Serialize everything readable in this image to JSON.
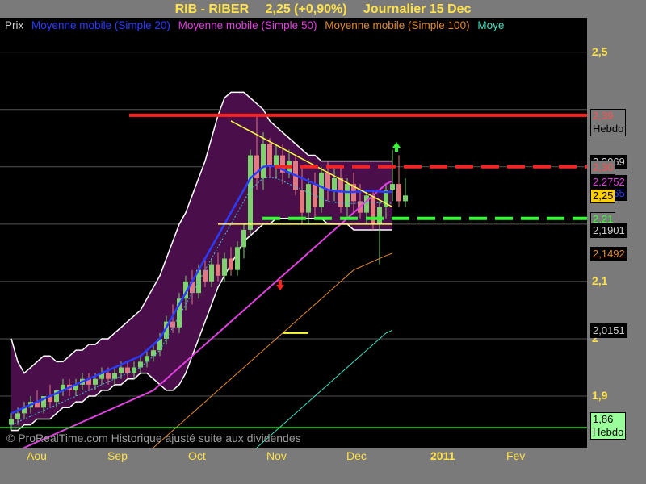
{
  "header": {
    "symbol": "RIB - RIBER",
    "price": "2,25 (+0,90%)",
    "period": "Journalier  15 Dec"
  },
  "legend": {
    "items": [
      {
        "label": "Prix",
        "color": "#cfcfcf"
      },
      {
        "label": "Moyenne mobile (Simple 20)",
        "color": "#2a3cff"
      },
      {
        "label": "Moyenne mobile (Simple 50)",
        "color": "#e040e0"
      },
      {
        "label": "Moyenne mobile (Simple 100)",
        "color": "#e08a30"
      },
      {
        "label": "Moye",
        "color": "#40e0c0"
      }
    ]
  },
  "watermark": "© ProRealTime.com Historique ajusté suite aux dividendes",
  "colors": {
    "background": "#000000",
    "axis_panel": "#7a7a7a",
    "axis_text": "#ffe14a",
    "bollinger_fill": "#4a0f4a",
    "up_candle": "#7ad46a",
    "down_candle": "#e07a80"
  },
  "chart_data": {
    "type": "candlestick",
    "ylim": [
      1.81,
      2.56
    ],
    "x_ticks": [
      "Aou",
      "Sep",
      "Oct",
      "Nov",
      "Dec",
      "2011",
      "Fev"
    ],
    "y_ticks": [
      "2,5",
      "2,1",
      "2",
      "1,9"
    ],
    "y_tick_values": [
      2.5,
      2.1,
      2.0,
      1.9
    ],
    "price_tags": [
      {
        "label": "2,39",
        "sub": "Hebdo",
        "value": 2.39,
        "bg": "#7a7a7a",
        "fg": "#ff5050"
      },
      {
        "label": "2,3069",
        "value": 2.31,
        "bg": "#000000",
        "fg": "#cfcfcf"
      },
      {
        "label": "2,30",
        "value": 2.3,
        "bg": "#7a7a7a",
        "fg": "#ff5050"
      },
      {
        "label": "2,2752",
        "value": 2.275,
        "bg": "#000000",
        "fg": "#e040e0"
      },
      {
        "label": "2,2565",
        "value": 2.255,
        "bg": "#000000",
        "fg": "#2a3cff"
      },
      {
        "label": "2,25",
        "value": 2.25,
        "bg": "#ffd000",
        "fg": "#000000"
      },
      {
        "label": "2,21",
        "value": 2.21,
        "bg": "#7a7a7a",
        "fg": "#40ff40"
      },
      {
        "label": "2,1901",
        "value": 2.19,
        "bg": "#000000",
        "fg": "#cfcfcf"
      },
      {
        "label": "2,1492",
        "value": 2.149,
        "bg": "#000000",
        "fg": "#e08a30"
      },
      {
        "label": "2,0151",
        "value": 2.015,
        "bg": "#000000",
        "fg": "#cfcfcf"
      },
      {
        "label": "1,86",
        "sub": "Hebdo",
        "value": 1.86,
        "bg": "#9aff9a",
        "fg": "#000000"
      }
    ],
    "levels": [
      {
        "value": 2.39,
        "color": "#ff2020",
        "style": "solid"
      },
      {
        "value": 2.3,
        "color": "#ff2020",
        "style": "dashed"
      },
      {
        "value": 2.21,
        "color": "#30ff30",
        "style": "dashed"
      },
      {
        "value": 1.845,
        "color": "#30ff30",
        "style": "solid"
      }
    ],
    "candles": [
      {
        "o": 1.85,
        "h": 1.87,
        "l": 1.84,
        "c": 1.86
      },
      {
        "o": 1.86,
        "h": 1.88,
        "l": 1.85,
        "c": 1.87
      },
      {
        "o": 1.87,
        "h": 1.89,
        "l": 1.86,
        "c": 1.88
      },
      {
        "o": 1.88,
        "h": 1.9,
        "l": 1.87,
        "c": 1.89
      },
      {
        "o": 1.89,
        "h": 1.91,
        "l": 1.88,
        "c": 1.88
      },
      {
        "o": 1.88,
        "h": 1.9,
        "l": 1.87,
        "c": 1.9
      },
      {
        "o": 1.9,
        "h": 1.92,
        "l": 1.88,
        "c": 1.89
      },
      {
        "o": 1.89,
        "h": 1.91,
        "l": 1.88,
        "c": 1.91
      },
      {
        "o": 1.91,
        "h": 1.93,
        "l": 1.9,
        "c": 1.92
      },
      {
        "o": 1.92,
        "h": 1.93,
        "l": 1.9,
        "c": 1.91
      },
      {
        "o": 1.91,
        "h": 1.93,
        "l": 1.9,
        "c": 1.92
      },
      {
        "o": 1.92,
        "h": 1.94,
        "l": 1.91,
        "c": 1.93
      },
      {
        "o": 1.93,
        "h": 1.94,
        "l": 1.91,
        "c": 1.92
      },
      {
        "o": 1.92,
        "h": 1.94,
        "l": 1.91,
        "c": 1.93
      },
      {
        "o": 1.93,
        "h": 1.95,
        "l": 1.92,
        "c": 1.94
      },
      {
        "o": 1.94,
        "h": 1.95,
        "l": 1.92,
        "c": 1.93
      },
      {
        "o": 1.93,
        "h": 1.95,
        "l": 1.92,
        "c": 1.94
      },
      {
        "o": 1.94,
        "h": 1.96,
        "l": 1.93,
        "c": 1.95
      },
      {
        "o": 1.95,
        "h": 1.96,
        "l": 1.93,
        "c": 1.94
      },
      {
        "o": 1.94,
        "h": 1.96,
        "l": 1.93,
        "c": 1.95
      },
      {
        "o": 1.95,
        "h": 1.97,
        "l": 1.94,
        "c": 1.96
      },
      {
        "o": 1.96,
        "h": 1.98,
        "l": 1.95,
        "c": 1.97
      },
      {
        "o": 1.97,
        "h": 1.99,
        "l": 1.96,
        "c": 1.98
      },
      {
        "o": 1.98,
        "h": 2.01,
        "l": 1.97,
        "c": 2.0
      },
      {
        "o": 2.0,
        "h": 2.04,
        "l": 1.99,
        "c": 2.03
      },
      {
        "o": 2.03,
        "h": 2.06,
        "l": 2.01,
        "c": 2.02
      },
      {
        "o": 2.02,
        "h": 2.08,
        "l": 2.01,
        "c": 2.07
      },
      {
        "o": 2.07,
        "h": 2.11,
        "l": 2.05,
        "c": 2.1
      },
      {
        "o": 2.1,
        "h": 2.12,
        "l": 2.06,
        "c": 2.08
      },
      {
        "o": 2.08,
        "h": 2.13,
        "l": 2.07,
        "c": 2.12
      },
      {
        "o": 2.12,
        "h": 2.14,
        "l": 2.09,
        "c": 2.1
      },
      {
        "o": 2.1,
        "h": 2.14,
        "l": 2.09,
        "c": 2.13
      },
      {
        "o": 2.13,
        "h": 2.15,
        "l": 2.1,
        "c": 2.11
      },
      {
        "o": 2.11,
        "h": 2.15,
        "l": 2.1,
        "c": 2.14
      },
      {
        "o": 2.14,
        "h": 2.16,
        "l": 2.11,
        "c": 2.12
      },
      {
        "o": 2.12,
        "h": 2.17,
        "l": 2.11,
        "c": 2.16
      },
      {
        "o": 2.16,
        "h": 2.2,
        "l": 2.14,
        "c": 2.19
      },
      {
        "o": 2.19,
        "h": 2.33,
        "l": 2.18,
        "c": 2.32
      },
      {
        "o": 2.32,
        "h": 2.39,
        "l": 2.26,
        "c": 2.28
      },
      {
        "o": 2.28,
        "h": 2.36,
        "l": 2.26,
        "c": 2.34
      },
      {
        "o": 2.34,
        "h": 2.35,
        "l": 2.28,
        "c": 2.3
      },
      {
        "o": 2.3,
        "h": 2.34,
        "l": 2.28,
        "c": 2.32
      },
      {
        "o": 2.32,
        "h": 2.34,
        "l": 2.27,
        "c": 2.29
      },
      {
        "o": 2.29,
        "h": 2.33,
        "l": 2.28,
        "c": 2.31
      },
      {
        "o": 2.31,
        "h": 2.32,
        "l": 2.25,
        "c": 2.26
      },
      {
        "o": 2.26,
        "h": 2.3,
        "l": 2.2,
        "c": 2.22
      },
      {
        "o": 2.22,
        "h": 2.28,
        "l": 2.2,
        "c": 2.27
      },
      {
        "o": 2.27,
        "h": 2.29,
        "l": 2.21,
        "c": 2.23
      },
      {
        "o": 2.23,
        "h": 2.3,
        "l": 2.22,
        "c": 2.29
      },
      {
        "o": 2.29,
        "h": 2.31,
        "l": 2.24,
        "c": 2.26
      },
      {
        "o": 2.26,
        "h": 2.3,
        "l": 2.24,
        "c": 2.28
      },
      {
        "o": 2.28,
        "h": 2.3,
        "l": 2.22,
        "c": 2.23
      },
      {
        "o": 2.23,
        "h": 2.28,
        "l": 2.21,
        "c": 2.27
      },
      {
        "o": 2.27,
        "h": 2.29,
        "l": 2.22,
        "c": 2.24
      },
      {
        "o": 2.24,
        "h": 2.27,
        "l": 2.21,
        "c": 2.22
      },
      {
        "o": 2.22,
        "h": 2.26,
        "l": 2.2,
        "c": 2.25
      },
      {
        "o": 2.25,
        "h": 2.26,
        "l": 2.19,
        "c": 2.2
      },
      {
        "o": 2.2,
        "h": 2.24,
        "l": 2.13,
        "c": 2.23
      },
      {
        "o": 2.23,
        "h": 2.27,
        "l": 2.21,
        "c": 2.26
      },
      {
        "o": 2.26,
        "h": 2.33,
        "l": 2.24,
        "c": 2.27
      },
      {
        "o": 2.27,
        "h": 2.32,
        "l": 2.23,
        "c": 2.24
      },
      {
        "o": 2.24,
        "h": 2.28,
        "l": 2.23,
        "c": 2.25
      }
    ],
    "sma20": [
      1.87,
      1.875,
      1.88,
      1.885,
      1.89,
      1.895,
      1.9,
      1.905,
      1.91,
      1.915,
      1.92,
      1.925,
      1.93,
      1.935,
      1.94,
      1.945,
      1.95,
      1.955,
      1.96,
      1.965,
      1.97,
      1.98,
      1.99,
      2.0,
      2.02,
      2.04,
      2.06,
      2.08,
      2.1,
      2.12,
      2.14,
      2.16,
      2.18,
      2.2,
      2.22,
      2.24,
      2.26,
      2.28,
      2.29,
      2.3,
      2.302,
      2.3,
      2.295,
      2.29,
      2.285,
      2.28,
      2.275,
      2.27,
      2.265,
      2.26,
      2.258,
      2.257,
      2.256,
      2.256,
      2.257,
      2.258,
      2.258,
      2.257,
      2.256,
      2.2565
    ],
    "sma50": [
      1.8,
      1.805,
      1.81,
      1.815,
      1.82,
      1.825,
      1.83,
      1.835,
      1.84,
      1.845,
      1.85,
      1.855,
      1.86,
      1.865,
      1.87,
      1.875,
      1.88,
      1.885,
      1.89,
      1.895,
      1.9,
      1.905,
      1.91,
      1.92,
      1.93,
      1.94,
      1.95,
      1.96,
      1.97,
      1.98,
      1.99,
      2.0,
      2.01,
      2.02,
      2.03,
      2.04,
      2.05,
      2.06,
      2.07,
      2.08,
      2.09,
      2.1,
      2.11,
      2.12,
      2.13,
      2.14,
      2.15,
      2.16,
      2.17,
      2.18,
      2.19,
      2.2,
      2.21,
      2.22,
      2.23,
      2.24,
      2.25,
      2.26,
      2.27,
      2.2752
    ],
    "sma100": [
      null,
      null,
      null,
      null,
      null,
      null,
      null,
      null,
      null,
      null,
      null,
      null,
      null,
      null,
      null,
      null,
      null,
      null,
      null,
      null,
      null,
      null,
      1.81,
      1.82,
      1.83,
      1.84,
      1.85,
      1.86,
      1.87,
      1.88,
      1.89,
      1.9,
      1.91,
      1.92,
      1.93,
      1.94,
      1.95,
      1.96,
      1.97,
      1.98,
      1.99,
      2.0,
      2.01,
      2.02,
      2.03,
      2.04,
      2.05,
      2.06,
      2.07,
      2.08,
      2.09,
      2.1,
      2.11,
      2.12,
      2.125,
      2.13,
      2.135,
      2.14,
      2.145,
      2.1492
    ],
    "sma200": [
      null,
      null,
      null,
      null,
      null,
      null,
      null,
      null,
      null,
      null,
      null,
      null,
      null,
      null,
      null,
      null,
      null,
      null,
      null,
      null,
      null,
      null,
      null,
      null,
      null,
      null,
      null,
      null,
      null,
      null,
      null,
      null,
      null,
      null,
      null,
      null,
      null,
      null,
      1.81,
      1.82,
      1.83,
      1.84,
      1.85,
      1.86,
      1.87,
      1.88,
      1.89,
      1.9,
      1.91,
      1.92,
      1.93,
      1.94,
      1.95,
      1.96,
      1.97,
      1.98,
      1.99,
      2.0,
      2.01,
      2.015
    ],
    "boll_upper": [
      2.0,
      1.96,
      1.94,
      1.95,
      1.96,
      1.97,
      1.97,
      1.96,
      1.96,
      1.97,
      1.98,
      1.98,
      1.99,
      1.99,
      2.0,
      2.0,
      2.01,
      2.02,
      2.03,
      2.04,
      2.05,
      2.07,
      2.09,
      2.11,
      2.14,
      2.17,
      2.2,
      2.22,
      2.25,
      2.28,
      2.31,
      2.35,
      2.39,
      2.42,
      2.43,
      2.43,
      2.43,
      2.42,
      2.41,
      2.4,
      2.38,
      2.37,
      2.36,
      2.35,
      2.34,
      2.33,
      2.32,
      2.32,
      2.31,
      2.31,
      2.31,
      2.31,
      2.31,
      2.31,
      2.31,
      2.31,
      2.31,
      2.31,
      2.31,
      2.31
    ],
    "boll_lower": [
      1.84,
      1.84,
      1.85,
      1.85,
      1.86,
      1.86,
      1.86,
      1.87,
      1.88,
      1.88,
      1.89,
      1.89,
      1.9,
      1.9,
      1.91,
      1.91,
      1.92,
      1.92,
      1.93,
      1.93,
      1.94,
      1.94,
      1.93,
      1.92,
      1.91,
      1.91,
      1.92,
      1.94,
      1.97,
      2.0,
      2.03,
      2.06,
      2.09,
      2.11,
      2.13,
      2.15,
      2.17,
      2.18,
      2.19,
      2.2,
      2.2,
      2.21,
      2.21,
      2.21,
      2.21,
      2.21,
      2.21,
      2.21,
      2.21,
      2.2,
      2.2,
      2.2,
      2.2,
      2.19,
      2.19,
      2.19,
      2.19,
      2.19,
      2.19,
      2.19
    ]
  }
}
